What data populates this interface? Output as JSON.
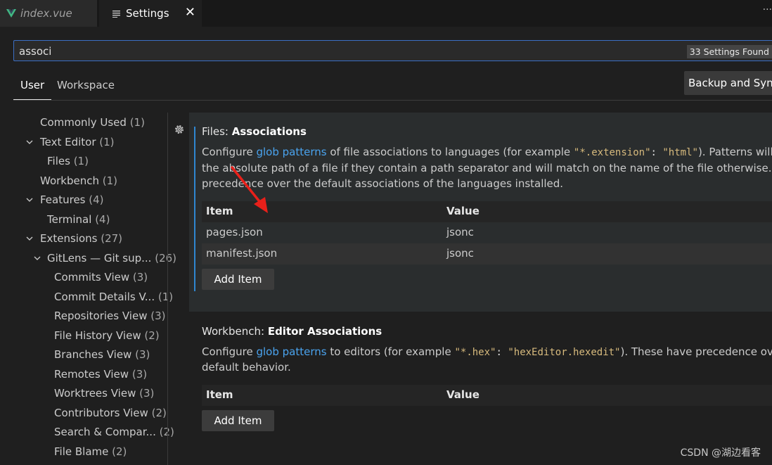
{
  "tabs": [
    {
      "label": "index.vue",
      "icon": "vue-icon"
    },
    {
      "label": "Settings",
      "icon": "lines-icon",
      "close": "✕"
    }
  ],
  "search": {
    "value": "associ",
    "results": "33 Settings Found"
  },
  "scope_tabs": [
    "User",
    "Workspace"
  ],
  "backup_button": "Backup and Sync Settings",
  "toc": [
    {
      "label": "Commonly Used",
      "count": "(1)"
    },
    {
      "label": "Text Editor",
      "count": "(1)",
      "expanded": true
    },
    {
      "label": "Files",
      "count": "(1)"
    },
    {
      "label": "Workbench",
      "count": "(1)"
    },
    {
      "label": "Features",
      "count": "(4)",
      "expanded": true
    },
    {
      "label": "Terminal",
      "count": "(4)"
    },
    {
      "label": "Extensions",
      "count": "(27)",
      "expanded": true
    },
    {
      "label": "GitLens — Git sup...",
      "count": "(26)",
      "expanded": true
    },
    {
      "label": "Commits View",
      "count": "(3)"
    },
    {
      "label": "Commit Details V...",
      "count": "(1)"
    },
    {
      "label": "Repositories View",
      "count": "(3)"
    },
    {
      "label": "File History View",
      "count": "(2)"
    },
    {
      "label": "Branches View",
      "count": "(3)"
    },
    {
      "label": "Remotes View",
      "count": "(3)"
    },
    {
      "label": "Worktrees View",
      "count": "(3)"
    },
    {
      "label": "Contributors View",
      "count": "(2)"
    },
    {
      "label": "Search & Compar...",
      "count": "(2)"
    },
    {
      "label": "File Blame",
      "count": "(2)"
    }
  ],
  "settings": [
    {
      "category": "Files: ",
      "name": "Associations",
      "desc_pre": "Configure ",
      "desc_link": "glob patterns",
      "desc_mid": " of file associations to languages (for example ",
      "code_key": "\"*.extension\"",
      "code_colon": ": ",
      "code_val": "\"html\"",
      "desc_post": "). Patterns will ma",
      "desc_line2": "the absolute path of a file if they contain a path separator and will match on the name of the file otherwise. These",
      "desc_line3": "precedence over the default associations of the languages installed.",
      "col_item": "Item",
      "col_value": "Value",
      "rows": [
        {
          "item": "pages.json",
          "value": "jsonc"
        },
        {
          "item": "manifest.json",
          "value": "jsonc"
        }
      ],
      "add_button": "Add Item"
    },
    {
      "category": "Workbench: ",
      "name": "Editor Associations",
      "desc_pre": "Configure ",
      "desc_link": "glob patterns",
      "desc_mid": " to editors (for example ",
      "code_key": "\"*.hex\"",
      "code_colon": ": ",
      "code_val": "\"hexEditor.hexedit\"",
      "desc_post": "). These have precedence over",
      "desc_line2": "default behavior.",
      "col_item": "Item",
      "col_value": "Value",
      "add_button": "Add Item"
    }
  ],
  "watermark": "CSDN @湖边看客",
  "colors": {
    "accent": "#2f87d1",
    "link": "#4aa3ee",
    "annotation": "#e8201a"
  }
}
